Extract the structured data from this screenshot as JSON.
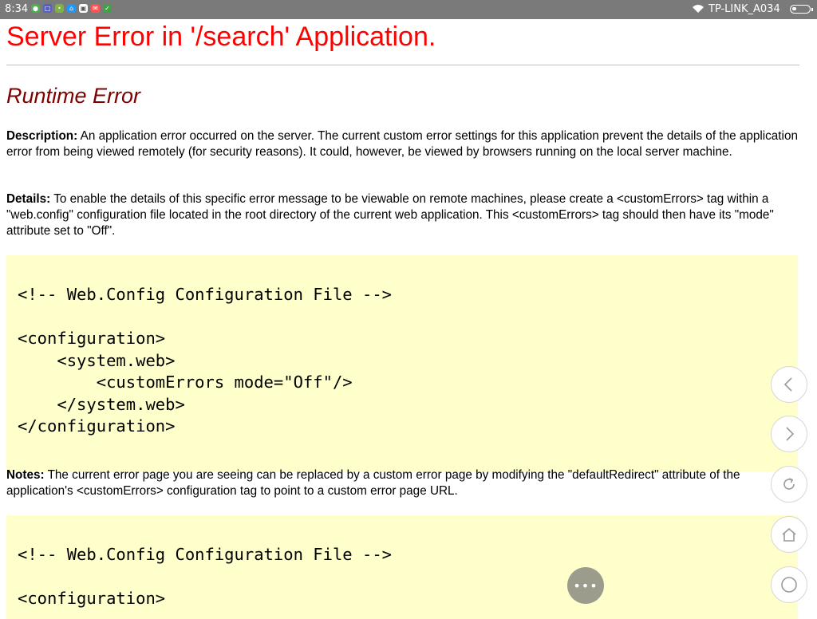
{
  "status_bar": {
    "time": "8:34",
    "notification_icons": [
      "wechat-icon",
      "square-icon",
      "app-icon",
      "app-icon",
      "image-icon",
      "mail-icon",
      "chat-icon"
    ],
    "ssid": "TP-LINK_A034",
    "battery_level": 0.3
  },
  "page": {
    "title": "Server Error in '/search' Application.",
    "error_heading": "Runtime Error",
    "description_label": "Description:",
    "description_text": " An application error occurred on the server. The current custom error settings for this application prevent the details of the application error from being viewed remotely (for security reasons). It could, however, be viewed by browsers running on the local server machine.",
    "details_label": "Details:",
    "details_text": " To enable the details of this specific error message to be viewable on remote machines, please create a <customErrors> tag within a \"web.config\" configuration file located in the root directory of the current web application. This <customErrors> tag should then have its \"mode\" attribute set to \"Off\".",
    "code1": "<!-- Web.Config Configuration File -->\n\n<configuration>\n    <system.web>\n        <customErrors mode=\"Off\"/>\n    </system.web>\n</configuration>",
    "notes_label": "Notes:",
    "notes_text": " The current error page you are seeing can be replaced by a custom error page by modifying the \"defaultRedirect\" attribute of the application's <customErrors> configuration tag to point to a custom error page URL.",
    "code2": "<!-- Web.Config Configuration File -->\n\n<configuration>"
  },
  "browser_nav": {
    "buttons": [
      "back-icon",
      "forward-icon",
      "refresh-icon",
      "home-icon",
      "circle-icon"
    ],
    "more_label": "•••"
  }
}
